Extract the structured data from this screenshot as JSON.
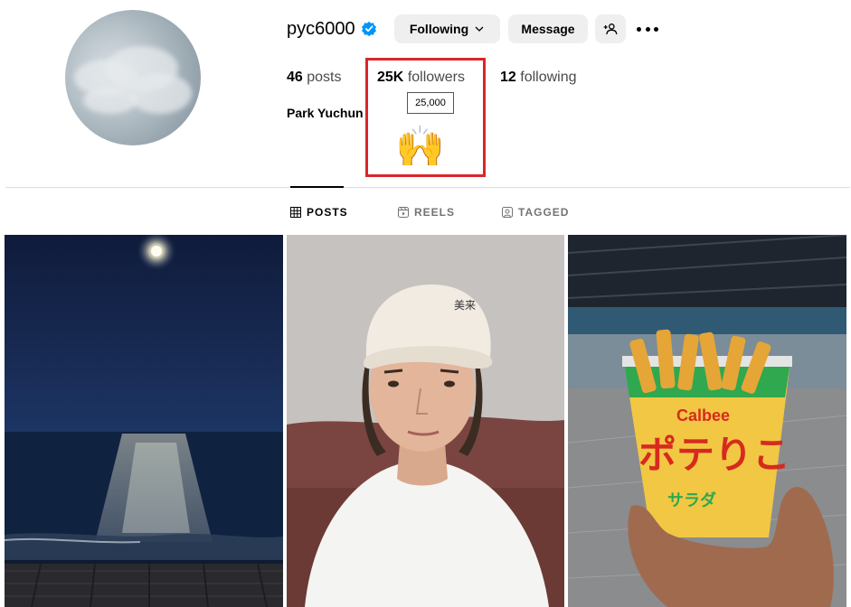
{
  "profile": {
    "username": "pyc6000",
    "full_name": "Park Yuchun",
    "verified": true
  },
  "actions": {
    "following_label": "Following",
    "message_label": "Message"
  },
  "stats": {
    "posts_count": "46",
    "posts_label": "posts",
    "followers_count": "25K",
    "followers_label": "followers",
    "following_count": "12",
    "following_label": "following"
  },
  "tooltip": {
    "followers_exact": "25,000"
  },
  "tabs": [
    {
      "label": "POSTS",
      "active": true,
      "icon": "grid-icon"
    },
    {
      "label": "REELS",
      "active": false,
      "icon": "reels-icon"
    },
    {
      "label": "TAGGED",
      "active": false,
      "icon": "tagged-icon"
    }
  ],
  "post3_brand": {
    "brand": "Calbee",
    "product": "ポテりこ",
    "flavor": "サラダ"
  },
  "colors": {
    "verified_blue": "#0095f6",
    "highlight_red": "#d9262b",
    "button_gray": "#efefef"
  }
}
